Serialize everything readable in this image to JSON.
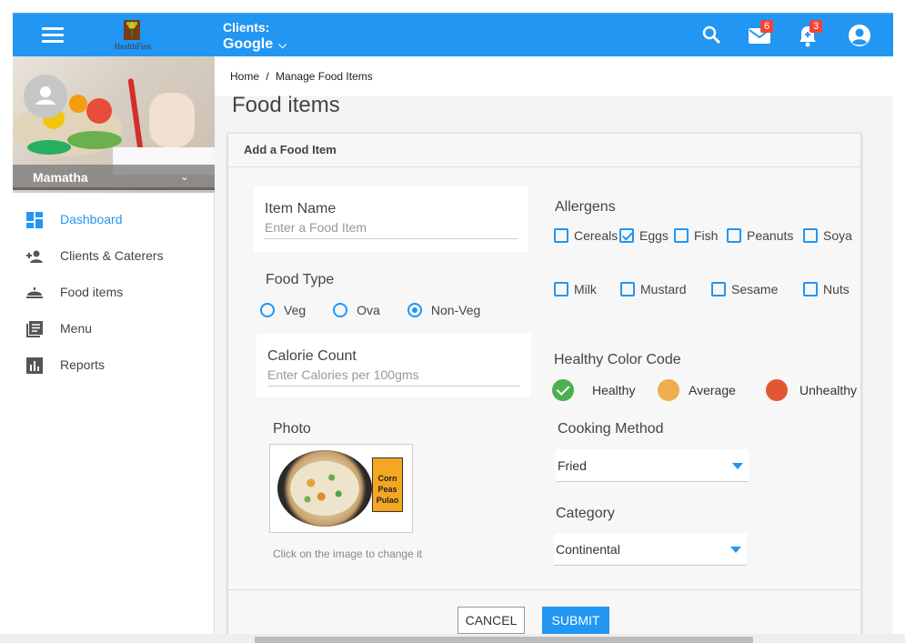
{
  "header": {
    "brand": "HealthFirst",
    "client_label": "Clients:",
    "client_value": "Google",
    "mail_count": "6",
    "notification_count": "3",
    "bg_color": "#2196f3"
  },
  "sidebar": {
    "user_name": "Mamatha",
    "items": [
      {
        "label": "Dashboard",
        "icon": "dashboard-icon"
      },
      {
        "label": "Clients & Caterers",
        "icon": "person-add-icon"
      },
      {
        "label": "Food items",
        "icon": "cloche-icon"
      },
      {
        "label": "Menu",
        "icon": "menu-list-icon"
      },
      {
        "label": "Reports",
        "icon": "bar-chart-icon"
      }
    ]
  },
  "breadcrumb": {
    "home": "Home",
    "separator": "/",
    "current": "Manage Food Items"
  },
  "page": {
    "title": "Food items"
  },
  "form": {
    "card_title": "Add a Food Item",
    "item_name": {
      "label": "Item Name",
      "placeholder": "Enter a Food Item"
    },
    "food_type": {
      "label": "Food Type",
      "options": [
        "Veg",
        "Ova",
        "Non-Veg"
      ],
      "selected": "Non-Veg"
    },
    "calorie": {
      "label": "Calorie Count",
      "placeholder": "Enter Calories per 100gms"
    },
    "photo": {
      "label": "Photo",
      "tag_lines": [
        "Corn",
        "Peas",
        "Pulao"
      ],
      "hint": "Click on  the image to change it"
    },
    "allergens": {
      "label": "Allergens",
      "items": [
        {
          "label": "Cereals",
          "checked": false
        },
        {
          "label": "Eggs",
          "checked": true
        },
        {
          "label": "Fish",
          "checked": false
        },
        {
          "label": "Peanuts",
          "checked": false
        },
        {
          "label": "Soya",
          "checked": false
        },
        {
          "label": "Milk",
          "checked": false
        },
        {
          "label": "Mustard",
          "checked": false
        },
        {
          "label": "Sesame",
          "checked": false
        },
        {
          "label": "Nuts",
          "checked": false
        }
      ]
    },
    "color_code": {
      "label": "Healthy Color Code",
      "options": [
        {
          "label": "Healthy",
          "color": "#4caf50",
          "selected": true
        },
        {
          "label": "Average",
          "color": "#f0ad4e",
          "selected": false
        },
        {
          "label": "Unhealthy",
          "color": "#e25733",
          "selected": false
        }
      ]
    },
    "cooking_method": {
      "label": "Cooking Method",
      "value": "Fried"
    },
    "category": {
      "label": "Category",
      "value": "Continental"
    },
    "cancel_label": "CANCEL",
    "submit_label": "SUBMIT"
  }
}
